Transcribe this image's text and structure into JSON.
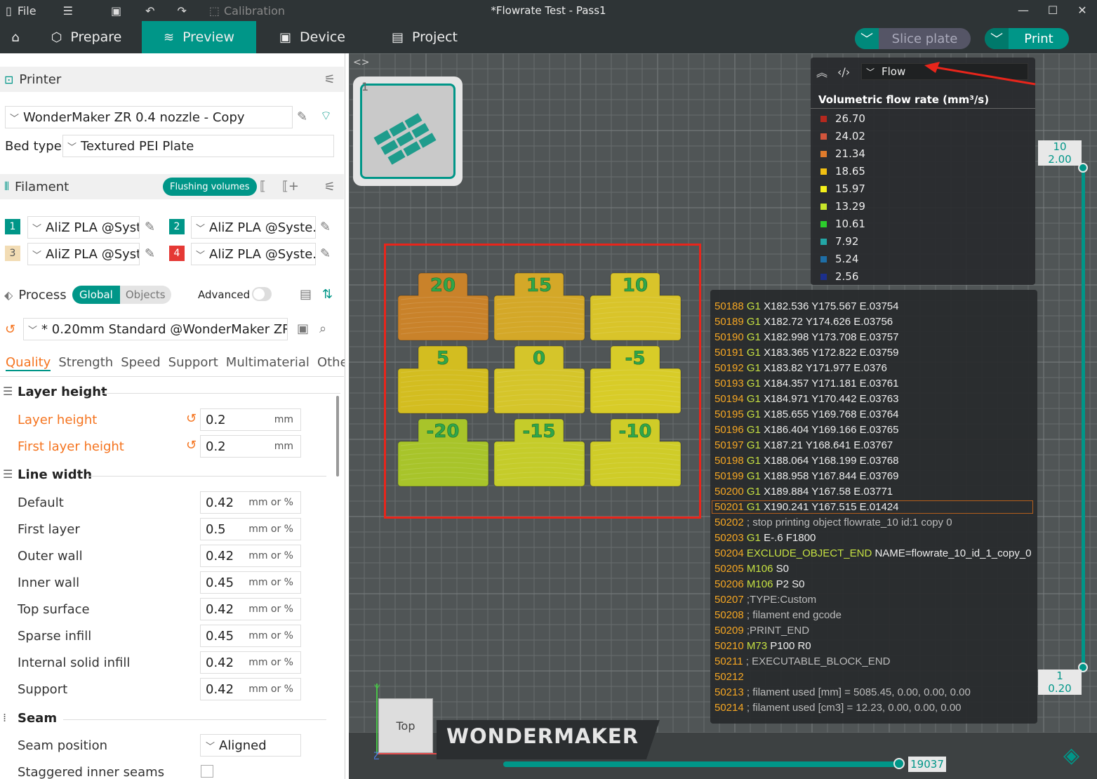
{
  "titlebar": {
    "file_label": "File",
    "calibration_label": "Calibration",
    "window_title": "*Flowrate Test - Pass1"
  },
  "tabs": {
    "prepare": "Prepare",
    "preview": "Preview",
    "device": "Device",
    "project": "Project",
    "slice_plate": "Slice plate",
    "print": "Print"
  },
  "printer": {
    "section_title": "Printer",
    "printer_name": "WonderMaker ZR 0.4 nozzle - Copy",
    "bed_type_label": "Bed type",
    "bed_type_value": "Textured PEI Plate"
  },
  "filament": {
    "section_title": "Filament",
    "flushing_button": "Flushing volumes",
    "slots": [
      {
        "num": "1",
        "color": "#009688",
        "name": "AliZ PLA @Syst..."
      },
      {
        "num": "2",
        "color": "#009688",
        "name": "AliZ PLA @Syste..."
      },
      {
        "num": "3",
        "color": "#f2dcb4",
        "name": "AliZ PLA @Syst..."
      },
      {
        "num": "4",
        "color": "#e53935",
        "name": "AliZ PLA @Syste..."
      }
    ]
  },
  "process": {
    "section_title": "Process",
    "global_label": "Global",
    "objects_label": "Objects",
    "advanced_label": "Advanced",
    "profile": "* 0.20mm Standard @WonderMaker ZR",
    "subtabs": [
      "Quality",
      "Strength",
      "Speed",
      "Support",
      "Multimaterial",
      "Others"
    ]
  },
  "settings": {
    "layer_height_group": "Layer height",
    "layer_height_label": "Layer height",
    "layer_height_value": "0.2",
    "first_layer_height_label": "First layer height",
    "first_layer_height_value": "0.2",
    "mm_unit": "mm",
    "line_width_group": "Line width",
    "mm_or_pct": "mm or %",
    "line_widths": [
      {
        "label": "Default",
        "value": "0.42"
      },
      {
        "label": "First layer",
        "value": "0.5"
      },
      {
        "label": "Outer wall",
        "value": "0.42"
      },
      {
        "label": "Inner wall",
        "value": "0.45"
      },
      {
        "label": "Top surface",
        "value": "0.42"
      },
      {
        "label": "Sparse infill",
        "value": "0.45"
      },
      {
        "label": "Internal solid infill",
        "value": "0.42"
      },
      {
        "label": "Support",
        "value": "0.42"
      }
    ],
    "seam_group": "Seam",
    "seam_position_label": "Seam position",
    "seam_position_value": "Aligned",
    "staggered_label": "Staggered inner seams"
  },
  "viewport": {
    "plate_number": "1",
    "view_type": "Flow",
    "legend_title": "Volumetric flow rate (mm³/s)",
    "legend": [
      {
        "value": "26.70",
        "color": "#b5281e"
      },
      {
        "value": "24.02",
        "color": "#d2553c"
      },
      {
        "value": "21.34",
        "color": "#e07b2c"
      },
      {
        "value": "18.65",
        "color": "#f2c012"
      },
      {
        "value": "15.97",
        "color": "#f5f01a"
      },
      {
        "value": "13.29",
        "color": "#c7e62a"
      },
      {
        "value": "10.61",
        "color": "#2ccd2c"
      },
      {
        "value": "7.92",
        "color": "#23a6a6"
      },
      {
        "value": "5.24",
        "color": "#1e6ea6"
      },
      {
        "value": "2.56",
        "color": "#1c2f8c"
      }
    ],
    "models": [
      {
        "label": "20",
        "color": "#c9822a",
        "row": 0,
        "col": 0
      },
      {
        "label": "15",
        "color": "#d4a828",
        "row": 0,
        "col": 1
      },
      {
        "label": "10",
        "color": "#d9c42a",
        "row": 0,
        "col": 2
      },
      {
        "label": "5",
        "color": "#d3bd20",
        "row": 1,
        "col": 0
      },
      {
        "label": "0",
        "color": "#d5c52a",
        "row": 1,
        "col": 1
      },
      {
        "label": "-5",
        "color": "#d8cc28",
        "row": 1,
        "col": 2
      },
      {
        "label": "-20",
        "color": "#a8c42a",
        "row": 2,
        "col": 0
      },
      {
        "label": "-15",
        "color": "#c5cc2a",
        "row": 2,
        "col": 1
      },
      {
        "label": "-10",
        "color": "#cfcc28",
        "row": 2,
        "col": 2
      }
    ],
    "gcode_lines": [
      {
        "n": "50188",
        "cmd": "G1",
        "rest": "X182.536 Y175.567 E.03754"
      },
      {
        "n": "50189",
        "cmd": "G1",
        "rest": "X182.72 Y174.626 E.03756"
      },
      {
        "n": "50190",
        "cmd": "G1",
        "rest": "X182.998 Y173.708 E.03757"
      },
      {
        "n": "50191",
        "cmd": "G1",
        "rest": "X183.365 Y172.822 E.03759"
      },
      {
        "n": "50192",
        "cmd": "G1",
        "rest": "X183.82 Y171.977 E.0376"
      },
      {
        "n": "50193",
        "cmd": "G1",
        "rest": "X184.357 Y171.181 E.03761"
      },
      {
        "n": "50194",
        "cmd": "G1",
        "rest": "X184.971 Y170.442 E.03763"
      },
      {
        "n": "50195",
        "cmd": "G1",
        "rest": "X185.655 Y169.768 E.03764"
      },
      {
        "n": "50196",
        "cmd": "G1",
        "rest": "X186.404 Y169.166 E.03765"
      },
      {
        "n": "50197",
        "cmd": "G1",
        "rest": "X187.21 Y168.641 E.03767"
      },
      {
        "n": "50198",
        "cmd": "G1",
        "rest": "X188.064 Y168.199 E.03768"
      },
      {
        "n": "50199",
        "cmd": "G1",
        "rest": "X188.958 Y167.844 E.03769"
      },
      {
        "n": "50200",
        "cmd": "G1",
        "rest": "X189.884 Y167.58 E.03771"
      },
      {
        "n": "50201",
        "cmd": "G1",
        "rest": "X190.241 Y167.515 E.01424",
        "hl": true
      },
      {
        "n": "50202",
        "cmd": "",
        "rest": "; stop printing object flowrate_10 id:1 copy 0",
        "comment": true
      },
      {
        "n": "50203",
        "cmd": "G1",
        "rest": "E-.6 F1800"
      },
      {
        "n": "50204",
        "cmd": "EXCLUDE_OBJECT_END",
        "rest": "NAME=flowrate_10_id_1_copy_0"
      },
      {
        "n": "50205",
        "cmd": "M106",
        "rest": "S0"
      },
      {
        "n": "50206",
        "cmd": "M106",
        "rest": "P2 S0"
      },
      {
        "n": "50207",
        "cmd": "",
        "rest": ";TYPE:Custom",
        "comment": true
      },
      {
        "n": "50208",
        "cmd": "",
        "rest": "; filament end gcode",
        "comment": true
      },
      {
        "n": "50209",
        "cmd": "",
        "rest": ";PRINT_END",
        "comment": true
      },
      {
        "n": "50210",
        "cmd": "M73",
        "rest": "P100 R0"
      },
      {
        "n": "50211",
        "cmd": "",
        "rest": "; EXECUTABLE_BLOCK_END",
        "comment": true
      },
      {
        "n": "50212",
        "cmd": "",
        "rest": "",
        "comment": true
      },
      {
        "n": "50213",
        "cmd": "",
        "rest": "; filament used [mm] = 5085.45, 0.00, 0.00, 0.00",
        "comment": true
      },
      {
        "n": "50214",
        "cmd": "",
        "rest": "; filament used [cm3] = 12.23, 0.00, 0.00, 0.00",
        "comment": true
      }
    ],
    "layer_top_num": "10",
    "layer_top_height": "2.00",
    "layer_bottom_num": "1",
    "layer_bottom_height": "0.20",
    "move_value": "19037",
    "cube_label": "Top",
    "brand": "WONDERMAKER",
    "axis_y": "Y",
    "axis_x": "X",
    "axis_z": "Z"
  }
}
